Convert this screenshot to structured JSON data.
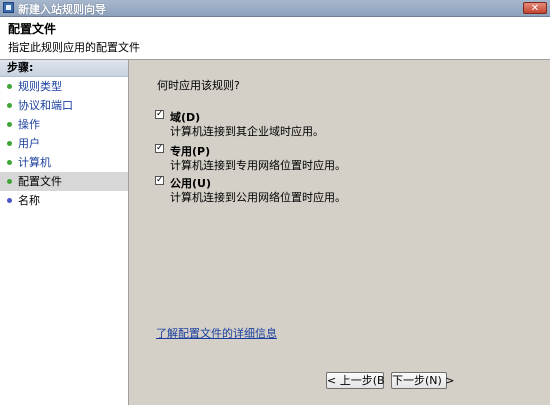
{
  "window": {
    "title": "新建入站规则向导",
    "close_glyph": "✕"
  },
  "header": {
    "title": "配置文件",
    "subtitle": "指定此规则应用的配置文件"
  },
  "sidebar": {
    "heading": "步骤:",
    "items": [
      {
        "label": "规则类型",
        "state": "done"
      },
      {
        "label": "协议和端口",
        "state": "done"
      },
      {
        "label": "操作",
        "state": "done"
      },
      {
        "label": "用户",
        "state": "done"
      },
      {
        "label": "计算机",
        "state": "done"
      },
      {
        "label": "配置文件",
        "state": "current"
      },
      {
        "label": "名称",
        "state": "pending"
      }
    ]
  },
  "main": {
    "question": "何时应用该规则?",
    "options": [
      {
        "label": "域(D)",
        "description": "计算机连接到其企业域时应用。",
        "checked": true,
        "check_glyph": "✓"
      },
      {
        "label": "专用(P)",
        "description": "计算机连接到专用网络位置时应用。",
        "checked": true,
        "check_glyph": "✓"
      },
      {
        "label": "公用(U)",
        "description": "计算机连接到公用网络位置时应用。",
        "checked": true,
        "check_glyph": "✓"
      }
    ],
    "link": "了解配置文件的详细信息"
  },
  "buttons": {
    "back": "< 上一步(B",
    "next": "下一步(N) >"
  },
  "colors": {
    "title_bar": "#8ea2bd",
    "done_dot": "#3fa535",
    "pending_dot": "#4a56c5",
    "link": "#1a3f9e"
  }
}
